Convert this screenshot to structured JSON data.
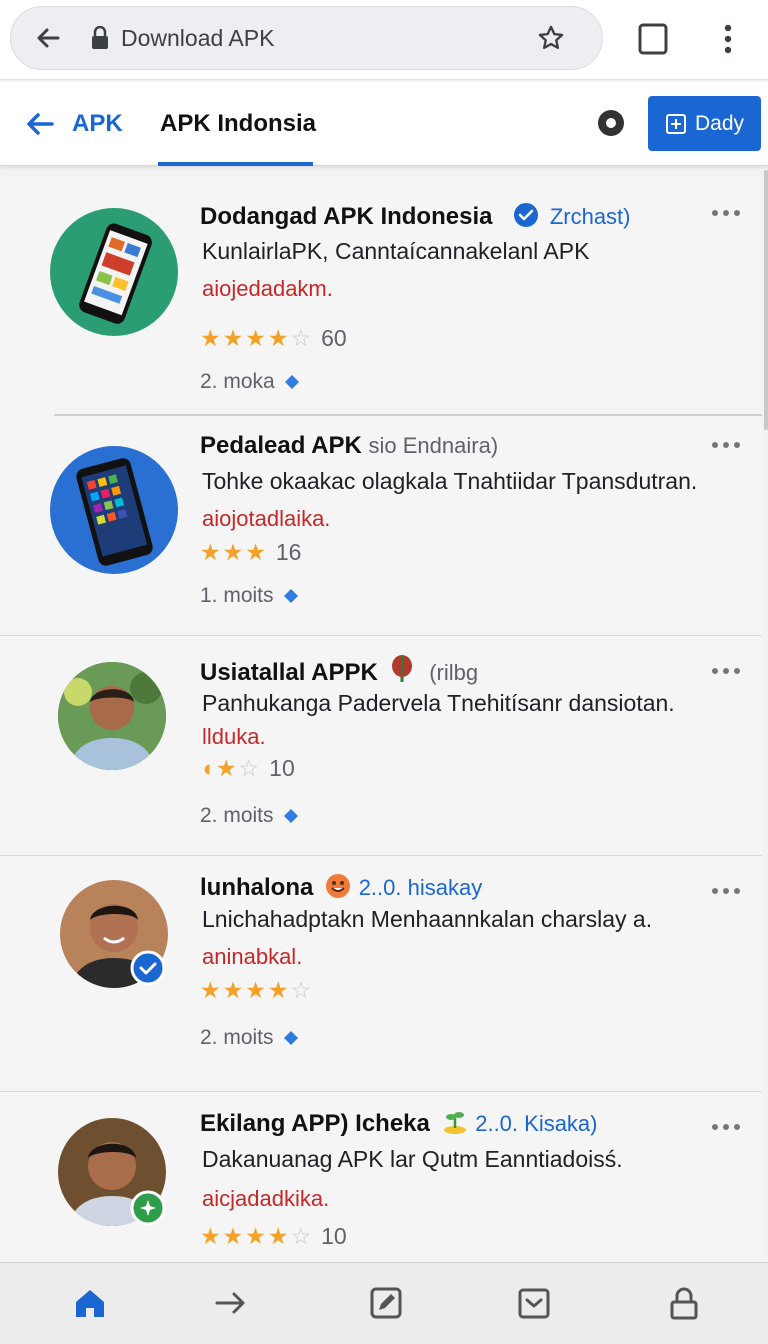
{
  "browser": {
    "url_text": "Download APK"
  },
  "appbar": {
    "back_label": "APK",
    "title": "APK Indonsia",
    "action_label": "Dady"
  },
  "accent_color": "#1a66d2",
  "cards": [
    {
      "name": "Dodangad APK Indonesia",
      "meta": "Zrchast)",
      "description": "KunlairlaPK, Canntaícannakelanl APK",
      "tag": "aiojedadakm.",
      "rating": 3.5,
      "rating_count": "60",
      "time": "2. moka",
      "avatar_icon": "phone-icon",
      "badge_icon": "verified-icon"
    },
    {
      "name": "Pedalead APK",
      "meta": "sio Endnaira)",
      "description": "Tohke okaakac olagkala Tnahtiidar Tpansdutran.",
      "tag": "aiojotadlaika.",
      "rating": 3,
      "rating_count": "16",
      "time": "1. moits",
      "avatar_icon": "phone-icon"
    },
    {
      "name": "Usiatallal APPK",
      "meta": "(rilbg",
      "description": "Panhukanga Padervela Tnehitísanr dansiotan.",
      "tag": "llduka.",
      "rating": 2,
      "rating_count": "10",
      "time": "2. moits",
      "avatar_icon": "person-avatar",
      "badge_icon": "leaf-icon"
    },
    {
      "name": "lunhalona",
      "meta": "2..0. hisakay",
      "description": "Lnichahadptakn Menhaannkalan charslay a.",
      "tag": "aninabkal.",
      "rating": 3.5,
      "rating_count": "",
      "time": "2. moits",
      "avatar_icon": "person-avatar",
      "badge_icon": "emoji-icon"
    },
    {
      "name": "Ekilang APP) Icheka",
      "meta": "2..0. Kisaka)",
      "description": "Dakanuanag APK lar Qutm Eanntiadoisś.",
      "tag": "aicjadadkika.",
      "rating": 3.5,
      "rating_count": "10",
      "time": "",
      "avatar_icon": "person-avatar",
      "badge_icon": "sprout-icon"
    }
  ],
  "bottom_nav": [
    "home-icon",
    "forward-arrow-icon",
    "edit-icon",
    "inbox-icon",
    "lock-icon"
  ]
}
